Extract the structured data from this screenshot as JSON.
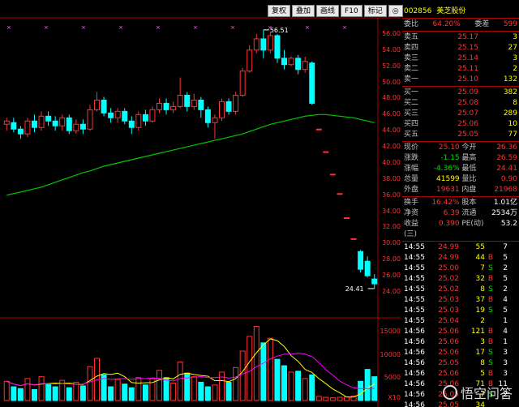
{
  "toolbar": {
    "buttons": [
      "复权",
      "叠加",
      "画线",
      "F10",
      "标记",
      "◎"
    ]
  },
  "price_axis": {
    "labels": [
      "56.00",
      "54.00",
      "52.00",
      "50.00",
      "48.00",
      "46.00",
      "44.00",
      "42.00",
      "40.00",
      "38.00",
      "36.00",
      "34.00",
      "32.00",
      "30.00",
      "28.00",
      "26.00",
      "24.00"
    ]
  },
  "volume_axis": {
    "labels": [
      "15000",
      "10000",
      "5000",
      "X10"
    ]
  },
  "annotations": {
    "high": "56.51",
    "low": "24.41"
  },
  "quote": {
    "code": "002856",
    "name": "美芝股份",
    "webi_label": "委比",
    "webi_value": "64.20%",
    "weicha_label": "委差",
    "weicha_value": "599",
    "asks": [
      {
        "label": "卖五",
        "price": "25.17",
        "vol": "3"
      },
      {
        "label": "卖四",
        "price": "25.15",
        "vol": "27"
      },
      {
        "label": "卖三",
        "price": "25.14",
        "vol": "3"
      },
      {
        "label": "卖二",
        "price": "25.11",
        "vol": "2"
      },
      {
        "label": "卖一",
        "price": "25.10",
        "vol": "132"
      }
    ],
    "bids": [
      {
        "label": "买一",
        "price": "25.09",
        "vol": "382"
      },
      {
        "label": "买二",
        "price": "25.08",
        "vol": "8"
      },
      {
        "label": "买三",
        "price": "25.07",
        "vol": "289"
      },
      {
        "label": "买四",
        "price": "25.06",
        "vol": "10"
      },
      {
        "label": "买五",
        "price": "25.05",
        "vol": "77"
      }
    ],
    "stats": [
      {
        "l1": "现价",
        "v1": "25.10",
        "l2": "今开",
        "v2": "26.36"
      },
      {
        "l1": "涨跌",
        "v1": "-1.15",
        "l2": "最高",
        "v2": "26.59"
      },
      {
        "l1": "涨幅",
        "v1": "-4.36%",
        "l2": "最低",
        "v2": "24.41"
      },
      {
        "l1": "总量",
        "v1": "41599",
        "l2": "量比",
        "v2": "0.90"
      },
      {
        "l1": "外盘",
        "v1": "19631",
        "l2": "内盘",
        "v2": "21968"
      }
    ],
    "stats2": [
      {
        "l1": "换手",
        "v1": "16.42%",
        "l2": "股本",
        "v2": "1.01亿"
      },
      {
        "l1": "净资",
        "v1": "6.39",
        "l2": "流通",
        "v2": "2534万"
      },
      {
        "l1": "收益(三)",
        "v1": "0.390",
        "l2": "PE(动)",
        "v2": "53.2"
      }
    ]
  },
  "ticks": [
    {
      "t": "14:55",
      "p": "24.99",
      "v": "55",
      "bs": "",
      "n": "7"
    },
    {
      "t": "14:55",
      "p": "24.99",
      "v": "44",
      "bs": "B",
      "n": "5"
    },
    {
      "t": "14:55",
      "p": "25.00",
      "v": "7",
      "bs": "S",
      "n": "2"
    },
    {
      "t": "14:55",
      "p": "25.02",
      "v": "32",
      "bs": "B",
      "n": "5"
    },
    {
      "t": "14:55",
      "p": "25.02",
      "v": "8",
      "bs": "S",
      "n": "2"
    },
    {
      "t": "14:55",
      "p": "25.03",
      "v": "37",
      "bs": "B",
      "n": "4"
    },
    {
      "t": "14:55",
      "p": "25.03",
      "v": "19",
      "bs": "S",
      "n": "5"
    },
    {
      "t": "14:55",
      "p": "25.04",
      "v": "2",
      "bs": "",
      "n": "1"
    },
    {
      "t": "14:56",
      "p": "25.06",
      "v": "121",
      "bs": "B",
      "n": "4"
    },
    {
      "t": "14:56",
      "p": "25.06",
      "v": "3",
      "bs": "B",
      "n": "1"
    },
    {
      "t": "14:56",
      "p": "25.06",
      "v": "17",
      "bs": "S",
      "n": "3"
    },
    {
      "t": "14:56",
      "p": "25.05",
      "v": "8",
      "bs": "S",
      "n": "3"
    },
    {
      "t": "14:56",
      "p": "25.06",
      "v": "5",
      "bs": "B",
      "n": "3"
    },
    {
      "t": "14:56",
      "p": "25.06",
      "v": "71",
      "bs": "B",
      "n": "11"
    },
    {
      "t": "14:56",
      "p": "25.05",
      "v": "7",
      "bs": "S",
      "n": "2"
    },
    {
      "t": "14:56",
      "p": "25.05",
      "v": "34",
      "bs": "",
      "n": ""
    }
  ],
  "watermark": "悟空问答",
  "chart_data": {
    "type": "candlestick",
    "high_label": "56.51",
    "low_label": "24.41",
    "ylim": [
      24,
      56.8
    ],
    "candles": [
      [
        44.8,
        45.2,
        44.0,
        45.6
      ],
      [
        45.0,
        44.2,
        43.8,
        45.6
      ],
      [
        44.2,
        43.6,
        43.0,
        44.6
      ],
      [
        43.6,
        45.2,
        43.2,
        45.6
      ],
      [
        45.2,
        44.4,
        43.8,
        46.0
      ],
      [
        44.4,
        45.8,
        44.0,
        46.4
      ],
      [
        45.8,
        45.2,
        44.6,
        46.4
      ],
      [
        45.2,
        44.6,
        44.0,
        45.8
      ],
      [
        44.6,
        45.6,
        44.0,
        46.0
      ],
      [
        45.6,
        44.0,
        43.6,
        46.0
      ],
      [
        44.0,
        44.8,
        43.6,
        45.4
      ],
      [
        44.8,
        44.2,
        43.6,
        45.4
      ],
      [
        44.2,
        46.6,
        44.0,
        47.2
      ],
      [
        46.6,
        47.8,
        46.4,
        48.8
      ],
      [
        47.8,
        46.2,
        45.8,
        48.2
      ],
      [
        46.2,
        45.6,
        45.0,
        46.8
      ],
      [
        45.6,
        46.4,
        45.0,
        46.8
      ],
      [
        46.4,
        45.2,
        44.8,
        46.8
      ],
      [
        45.2,
        44.4,
        43.6,
        45.8
      ],
      [
        44.4,
        46.0,
        44.0,
        46.4
      ],
      [
        46.0,
        45.2,
        44.6,
        46.6
      ],
      [
        45.2,
        46.6,
        45.0,
        47.0
      ],
      [
        46.6,
        47.4,
        46.2,
        48.0
      ],
      [
        47.4,
        46.6,
        46.0,
        48.0
      ],
      [
        46.6,
        47.0,
        46.2,
        47.6
      ],
      [
        47.0,
        48.4,
        46.8,
        50.6
      ],
      [
        48.4,
        47.0,
        46.4,
        48.8
      ],
      [
        47.0,
        47.8,
        46.6,
        48.6
      ],
      [
        47.8,
        46.6,
        45.6,
        48.2
      ],
      [
        46.6,
        45.0,
        44.4,
        47.0
      ],
      [
        45.0,
        45.6,
        43.0,
        46.0
      ],
      [
        45.6,
        47.6,
        45.2,
        48.0
      ],
      [
        47.6,
        46.4,
        46.0,
        48.0
      ],
      [
        46.4,
        48.4,
        46.0,
        48.8
      ],
      [
        48.4,
        51.4,
        48.2,
        51.8
      ],
      [
        51.4,
        54.0,
        51.2,
        54.6
      ],
      [
        54.0,
        55.4,
        53.6,
        56.0
      ],
      [
        55.4,
        54.0,
        53.0,
        56.51
      ],
      [
        54.0,
        55.8,
        53.6,
        56.2
      ],
      [
        55.8,
        53.0,
        52.4,
        56.0
      ],
      [
        53.0,
        52.2,
        51.6,
        54.0
      ],
      [
        52.2,
        53.0,
        52.0,
        53.2
      ],
      [
        53.0,
        51.6,
        51.0,
        53.4
      ],
      [
        51.6,
        52.6,
        51.2,
        53.2
      ],
      [
        52.4,
        47.4,
        47.2,
        52.6
      ],
      [
        44.2,
        44.2,
        44.2,
        44.2
      ],
      [
        41.4,
        41.4,
        41.4,
        41.4
      ],
      [
        38.6,
        38.6,
        38.6,
        38.6
      ],
      [
        36.2,
        36.2,
        36.2,
        36.2
      ],
      [
        33.2,
        33.2,
        33.2,
        33.2
      ],
      [
        30.6,
        30.6,
        30.6,
        30.6
      ],
      [
        29.0,
        26.8,
        26.4,
        29.2
      ],
      [
        27.8,
        26.0,
        25.8,
        28.4
      ],
      [
        25.6,
        25.0,
        24.41,
        26.2
      ]
    ],
    "ma": [
      36.0,
      36.2,
      36.4,
      36.6,
      36.8,
      37.0,
      37.3,
      37.6,
      37.9,
      38.2,
      38.5,
      38.8,
      39.0,
      39.3,
      39.6,
      39.8,
      40.0,
      40.2,
      40.4,
      40.6,
      40.8,
      41.0,
      41.2,
      41.4,
      41.6,
      41.8,
      42.0,
      42.2,
      42.4,
      42.6,
      42.8,
      43.0,
      43.2,
      43.4,
      43.6,
      43.9,
      44.2,
      44.5,
      44.8,
      45.0,
      45.2,
      45.4,
      45.6,
      45.8,
      45.9,
      46.0,
      46.0,
      45.9,
      45.8,
      45.7,
      45.6,
      45.4,
      45.2,
      45.0
    ],
    "volume": [
      4200,
      3000,
      2600,
      4800,
      2400,
      5200,
      3600,
      3000,
      4400,
      2800,
      4000,
      3200,
      7400,
      9200,
      5600,
      3000,
      4600,
      3600,
      2800,
      5000,
      3400,
      4800,
      6600,
      5000,
      3800,
      8400,
      6000,
      5200,
      4000,
      3000,
      3400,
      6200,
      4000,
      7200,
      10800,
      14000,
      16200,
      12600,
      13600,
      9000,
      7600,
      6200,
      6400,
      4800,
      5600,
      900,
      700,
      600,
      700,
      800,
      1000,
      4200,
      6800,
      5200
    ],
    "vol_ylim": [
      0,
      17000
    ]
  }
}
